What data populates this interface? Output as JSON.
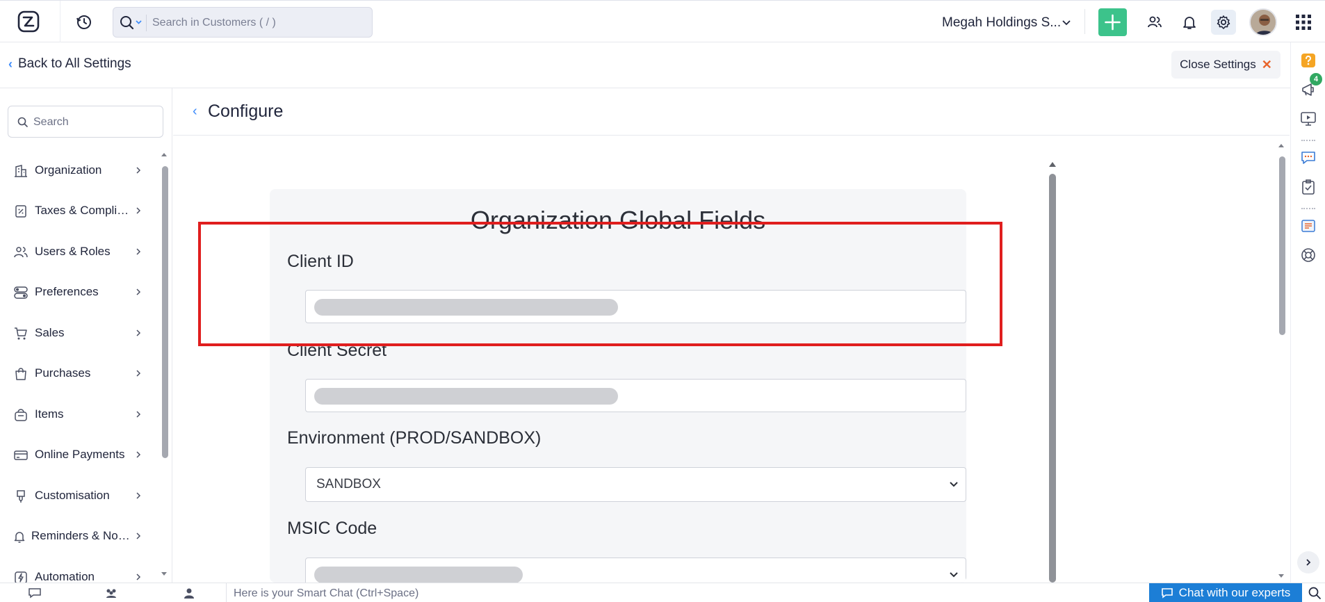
{
  "topbar": {
    "search_placeholder": "Search in Customers ( / )",
    "org_name": "Megah Holdings S...",
    "colors": {
      "add_button": "#3cc38b",
      "gear_bg": "#e8eef6"
    },
    "icons": [
      "app-logo-icon",
      "recent-history-icon",
      "search-icon",
      "chevron-down-icon",
      "plus-icon",
      "users-icon",
      "bell-icon",
      "gear-icon",
      "avatar",
      "apps-grid-icon"
    ]
  },
  "settings_header": {
    "back_label": "Back to All Settings",
    "close_label": "Close Settings"
  },
  "leftnav": {
    "search_placeholder": "Search",
    "items": [
      {
        "label": "Organization",
        "icon": "building-icon"
      },
      {
        "label": "Taxes & Compliance",
        "icon": "tax-icon"
      },
      {
        "label": "Users & Roles",
        "icon": "users-icon"
      },
      {
        "label": "Preferences",
        "icon": "toggles-icon"
      },
      {
        "label": "Sales",
        "icon": "cart-icon"
      },
      {
        "label": "Purchases",
        "icon": "bag-icon"
      },
      {
        "label": "Items",
        "icon": "basket-icon"
      },
      {
        "label": "Online Payments",
        "icon": "card-icon"
      },
      {
        "label": "Customisation",
        "icon": "brush-icon"
      },
      {
        "label": "Reminders & Notifications",
        "icon": "bell-icon"
      },
      {
        "label": "Automation",
        "icon": "lightning-icon"
      }
    ]
  },
  "page": {
    "title": "Configure",
    "card": {
      "title": "Organization Global Fields",
      "fields": [
        {
          "label": "Client ID",
          "value": "",
          "redacted": true
        },
        {
          "label": "Client Secret",
          "value": "",
          "redacted": true
        },
        {
          "label": "Environment (PROD/SANDBOX)",
          "value": "SANDBOX",
          "type": "select"
        },
        {
          "label": "MSIC Code",
          "value": "",
          "redacted": true,
          "type": "select"
        }
      ]
    },
    "highlight_color": "#e01e1e"
  },
  "right_rail": {
    "notification_count": "4",
    "icons": [
      "help-icon",
      "announcement-icon",
      "video-icon",
      "chat-bubble-icon",
      "checklist-icon",
      "books-icon",
      "support-icon",
      "expand-icon"
    ]
  },
  "bottombar": {
    "tabs": [
      {
        "label": "Chats",
        "icon": "chat-icon"
      },
      {
        "label": "Channels",
        "icon": "channels-icon"
      },
      {
        "label": "Contacts",
        "icon": "contacts-icon"
      }
    ],
    "smart_chat_placeholder": "Here is your Smart Chat (Ctrl+Space)",
    "chat_experts_label": "Chat with our experts",
    "chat_experts_color": "#1c7ed6"
  }
}
